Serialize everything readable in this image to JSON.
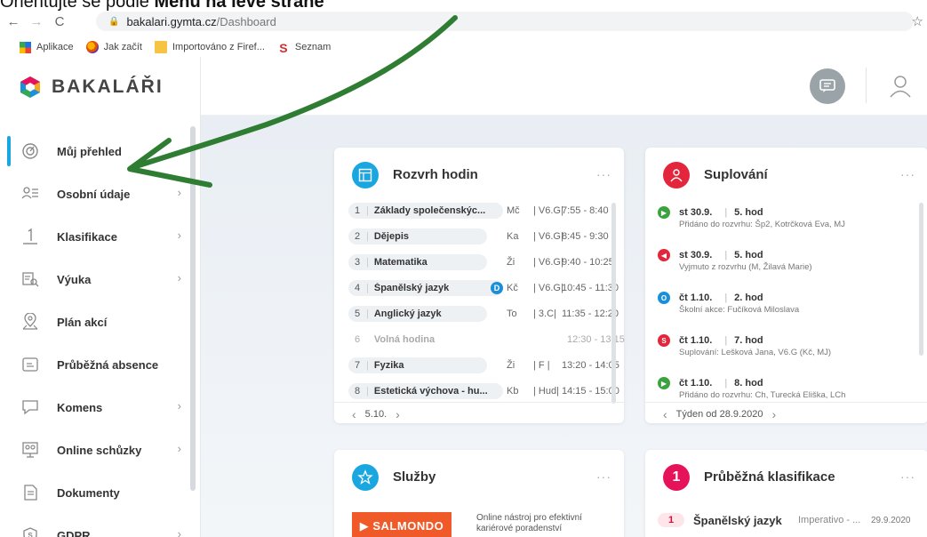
{
  "caption": {
    "prefix": "Orientujte se podle ",
    "bold": "Menu na levé straně"
  },
  "browser": {
    "url_host": "bakalari.gymta.cz",
    "url_path": "/Dashboard",
    "bookmarks": [
      {
        "label": "Aplikace",
        "icon": "apps-grid-icon"
      },
      {
        "label": "Jak začít",
        "icon": "firefox-icon"
      },
      {
        "label": "Importováno z Firef...",
        "icon": "folder-icon"
      },
      {
        "label": "Seznam",
        "icon": "seznam-icon"
      }
    ]
  },
  "app": {
    "logo": "BAKALÁŘI"
  },
  "sidebar": {
    "items": [
      {
        "label": "Můj přehled",
        "icon": "dashboard-icon",
        "active": true,
        "chevron": false
      },
      {
        "label": "Osobní údaje",
        "icon": "personal-info-icon",
        "chevron": true
      },
      {
        "label": "Klasifikace",
        "icon": "grade-icon",
        "chevron": true
      },
      {
        "label": "Výuka",
        "icon": "teaching-icon",
        "chevron": true
      },
      {
        "label": "Plán akcí",
        "icon": "map-pin-icon",
        "chevron": false
      },
      {
        "label": "Průběžná absence",
        "icon": "absence-icon",
        "chevron": false
      },
      {
        "label": "Komens",
        "icon": "message-icon",
        "chevron": true
      },
      {
        "label": "Online schůzky",
        "icon": "online-meeting-icon",
        "chevron": true
      },
      {
        "label": "Dokumenty",
        "icon": "document-icon",
        "chevron": false
      },
      {
        "label": "GDPR",
        "icon": "gdpr-shield-icon",
        "chevron": true
      }
    ],
    "chevron_glyph": "›"
  },
  "schedule": {
    "title": "Rozvrh hodin",
    "dots": "···",
    "rows": [
      {
        "num": "1",
        "subject": "Základy společenskýc...",
        "teacher": "Mč",
        "room": "V6.G",
        "time": "7:55 - 8:40"
      },
      {
        "num": "2",
        "subject": "Dějepis",
        "teacher": "Ka",
        "room": "V6.G",
        "time": "8:45 - 9:30"
      },
      {
        "num": "3",
        "subject": "Matematika",
        "teacher": "Ži",
        "room": "V6.G",
        "time": "9:40 - 10:25"
      },
      {
        "num": "4",
        "subject": "Španělský jazyk",
        "teacher": "Kč",
        "room": "V6.G",
        "time": "10:45 - 11:30",
        "badge": "D"
      },
      {
        "num": "5",
        "subject": "Anglický jazyk",
        "teacher": "To",
        "room": "3.C",
        "time": "11:35 - 12:20"
      },
      {
        "num": "6",
        "subject": "Volná hodina",
        "teacher": "",
        "room": "",
        "time": "12:30 - 13:15",
        "free": true
      },
      {
        "num": "7",
        "subject": "Fyzika",
        "teacher": "Ži",
        "room": "F",
        "time": "13:20 - 14:05"
      },
      {
        "num": "8",
        "subject": "Estetická výchova - hu...",
        "teacher": "Kb",
        "room": "Hud",
        "time": "14:15 - 15:00"
      }
    ],
    "footer_date": "5.10."
  },
  "substitutions": {
    "title": "Suplování",
    "dots": "···",
    "entries": [
      {
        "day": "st 30.9.",
        "hour": "5. hod",
        "detail": "Přidáno do rozvrhu: Šp2, Kotrčková Eva, MJ",
        "color": "#3aa33f",
        "glyph": "▶"
      },
      {
        "day": "st 30.9.",
        "hour": "5. hod",
        "detail": "Vyjmuto z rozvrhu (M, Žilavá Marie)",
        "color": "#e3263b",
        "glyph": "◀"
      },
      {
        "day": "čt 1.10.",
        "hour": "2. hod",
        "detail": "Školní akce: Fučíková Miloslava",
        "color": "#1b8fd8",
        "glyph": "O"
      },
      {
        "day": "čt 1.10.",
        "hour": "7. hod",
        "detail": "Suplování: Lešková Jana, V6.G (Kč, MJ)",
        "color": "#e3263b",
        "glyph": "S"
      },
      {
        "day": "čt 1.10.",
        "hour": "8. hod",
        "detail": "Přidáno do rozvrhu: Ch, Turecká Eliška, LCh",
        "color": "#3aa33f",
        "glyph": "▶"
      }
    ],
    "footer": "Týden od 28.9.2020"
  },
  "services": {
    "title": "Služby",
    "dots": "···",
    "salmondo_label": "▶ SALMONDO",
    "salmondo_desc": "Online nástroj pro efektivní kariérové poradenství"
  },
  "grades": {
    "title": "Průběžná klasifikace",
    "dots": "···",
    "icon_text": "1",
    "row": {
      "grade": "1",
      "subject": "Španělský jazyk",
      "type": "Imperativo - ...",
      "date": "29.9.2020"
    }
  },
  "colors": {
    "accent": "#1aa7e0",
    "schedule_icon": "#1aa7e0",
    "substitution_icon": "#e3263b",
    "services_icon": "#1aa7e0",
    "grades_icon": "#e6125a",
    "annotation_arrow": "#2e7d32"
  }
}
